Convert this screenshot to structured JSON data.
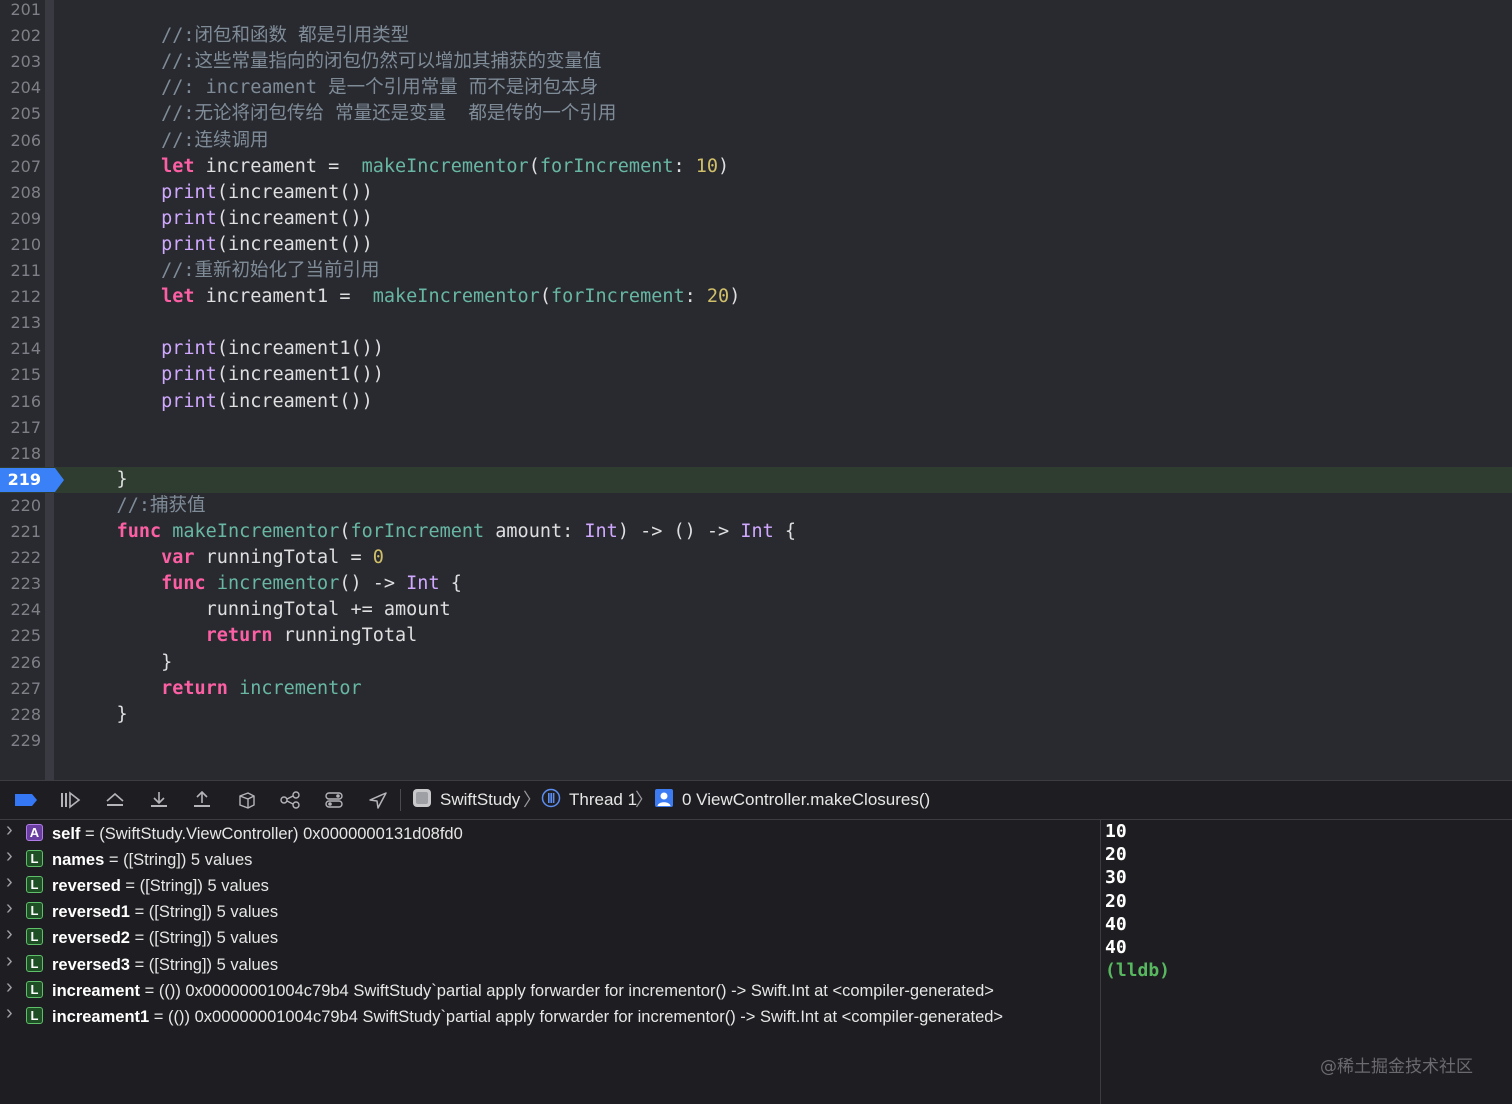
{
  "editor": {
    "lines": [
      {
        "n": "201",
        "code": []
      },
      {
        "n": "202",
        "code": [
          {
            "t": "        //:闭包和函数 都是引用类型",
            "c": "cm"
          }
        ]
      },
      {
        "n": "203",
        "code": [
          {
            "t": "        //:这些常量指向的闭包仍然可以增加其捕获的变量值",
            "c": "cm"
          }
        ]
      },
      {
        "n": "204",
        "code": [
          {
            "t": "        //: increament 是一个引用常量 而不是闭包本身",
            "c": "cm"
          }
        ]
      },
      {
        "n": "205",
        "code": [
          {
            "t": "        //:无论将闭包传给 常量还是变量  都是传的一个引用",
            "c": "cm"
          }
        ]
      },
      {
        "n": "206",
        "code": [
          {
            "t": "        //:连续调用",
            "c": "cm"
          }
        ]
      },
      {
        "n": "207",
        "code": [
          {
            "t": "        "
          },
          {
            "t": "let",
            "c": "kw"
          },
          {
            "t": " increament =  "
          },
          {
            "t": "makeIncrementor",
            "c": "fn"
          },
          {
            "t": "("
          },
          {
            "t": "forIncrement",
            "c": "fn"
          },
          {
            "t": ": "
          },
          {
            "t": "10",
            "c": "num"
          },
          {
            "t": ")"
          }
        ]
      },
      {
        "n": "208",
        "code": [
          {
            "t": "        "
          },
          {
            "t": "print",
            "c": "ty"
          },
          {
            "t": "(increament())"
          }
        ]
      },
      {
        "n": "209",
        "code": [
          {
            "t": "        "
          },
          {
            "t": "print",
            "c": "ty"
          },
          {
            "t": "(increament())"
          }
        ]
      },
      {
        "n": "210",
        "code": [
          {
            "t": "        "
          },
          {
            "t": "print",
            "c": "ty"
          },
          {
            "t": "(increament())"
          }
        ]
      },
      {
        "n": "211",
        "code": [
          {
            "t": "        //:重新初始化了当前引用",
            "c": "cm"
          }
        ]
      },
      {
        "n": "212",
        "code": [
          {
            "t": "        "
          },
          {
            "t": "let",
            "c": "kw"
          },
          {
            "t": " increament1 =  "
          },
          {
            "t": "makeIncrementor",
            "c": "fn"
          },
          {
            "t": "("
          },
          {
            "t": "forIncrement",
            "c": "fn"
          },
          {
            "t": ": "
          },
          {
            "t": "20",
            "c": "num"
          },
          {
            "t": ")"
          }
        ]
      },
      {
        "n": "213",
        "code": []
      },
      {
        "n": "214",
        "code": [
          {
            "t": "        "
          },
          {
            "t": "print",
            "c": "ty"
          },
          {
            "t": "(increament1())"
          }
        ]
      },
      {
        "n": "215",
        "code": [
          {
            "t": "        "
          },
          {
            "t": "print",
            "c": "ty"
          },
          {
            "t": "(increament1())"
          }
        ]
      },
      {
        "n": "216",
        "code": [
          {
            "t": "        "
          },
          {
            "t": "print",
            "c": "ty"
          },
          {
            "t": "(increament())"
          }
        ]
      },
      {
        "n": "217",
        "code": []
      },
      {
        "n": "218",
        "code": []
      },
      {
        "n": "219",
        "code": [
          {
            "t": "    }"
          }
        ],
        "current": true
      },
      {
        "n": "220",
        "code": [
          {
            "t": "    //:捕获值",
            "c": "cm"
          }
        ]
      },
      {
        "n": "221",
        "code": [
          {
            "t": "    "
          },
          {
            "t": "func",
            "c": "kw"
          },
          {
            "t": " "
          },
          {
            "t": "makeIncrementor",
            "c": "fn"
          },
          {
            "t": "("
          },
          {
            "t": "forIncrement",
            "c": "fn"
          },
          {
            "t": " amount: "
          },
          {
            "t": "Int",
            "c": "ty"
          },
          {
            "t": ") -> () -> "
          },
          {
            "t": "Int",
            "c": "ty"
          },
          {
            "t": " {"
          }
        ]
      },
      {
        "n": "222",
        "code": [
          {
            "t": "        "
          },
          {
            "t": "var",
            "c": "kw"
          },
          {
            "t": " runningTotal = "
          },
          {
            "t": "0",
            "c": "num"
          }
        ]
      },
      {
        "n": "223",
        "code": [
          {
            "t": "        "
          },
          {
            "t": "func",
            "c": "kw"
          },
          {
            "t": " "
          },
          {
            "t": "incrementor",
            "c": "fn"
          },
          {
            "t": "() -> "
          },
          {
            "t": "Int",
            "c": "ty"
          },
          {
            "t": " {"
          }
        ]
      },
      {
        "n": "224",
        "code": [
          {
            "t": "            runningTotal += amount"
          }
        ]
      },
      {
        "n": "225",
        "code": [
          {
            "t": "            "
          },
          {
            "t": "return",
            "c": "kw"
          },
          {
            "t": " runningTotal"
          }
        ]
      },
      {
        "n": "226",
        "code": [
          {
            "t": "        }"
          }
        ]
      },
      {
        "n": "227",
        "code": [
          {
            "t": "        "
          },
          {
            "t": "return",
            "c": "kw"
          },
          {
            "t": " "
          },
          {
            "t": "incrementor",
            "c": "fn"
          }
        ]
      },
      {
        "n": "228",
        "code": [
          {
            "t": "    }"
          }
        ]
      },
      {
        "n": "229",
        "code": []
      }
    ]
  },
  "debug_bar": {
    "icons": [
      "breakpoints-toggle-icon",
      "continue-icon",
      "step-over-icon",
      "step-into-icon",
      "step-out-icon",
      "view-hierarchy-icon",
      "memory-graph-icon",
      "environment-overrides-icon",
      "simulate-location-icon"
    ],
    "breadcrumb": {
      "target": "SwiftStudy",
      "thread": "Thread 1",
      "frame": "0 ViewController.makeClosures()"
    }
  },
  "variables": [
    {
      "kind": "A",
      "name": "self",
      "value": " = (SwiftStudy.ViewController) 0x0000000131d08fd0"
    },
    {
      "kind": "L",
      "name": "names",
      "value": " = ([String]) 5 values"
    },
    {
      "kind": "L",
      "name": "reversed",
      "value": " = ([String]) 5 values"
    },
    {
      "kind": "L",
      "name": "reversed1",
      "value": " = ([String]) 5 values"
    },
    {
      "kind": "L",
      "name": "reversed2",
      "value": " = ([String]) 5 values"
    },
    {
      "kind": "L",
      "name": "reversed3",
      "value": " = ([String]) 5 values"
    },
    {
      "kind": "L",
      "name": "increament",
      "value": " = (()) 0x00000001004c79b4 SwiftStudy`partial apply forwarder for incrementor() -> Swift.Int at <compiler-generated>"
    },
    {
      "kind": "L",
      "name": "increament1",
      "value": " = (()) 0x00000001004c79b4 SwiftStudy`partial apply forwarder for incrementor() -> Swift.Int at <compiler-generated>"
    }
  ],
  "console": {
    "output": [
      "10",
      "20",
      "30",
      "20",
      "40",
      "40"
    ],
    "prompt": "(lldb)"
  },
  "watermark": "@稀土掘金技术社区"
}
